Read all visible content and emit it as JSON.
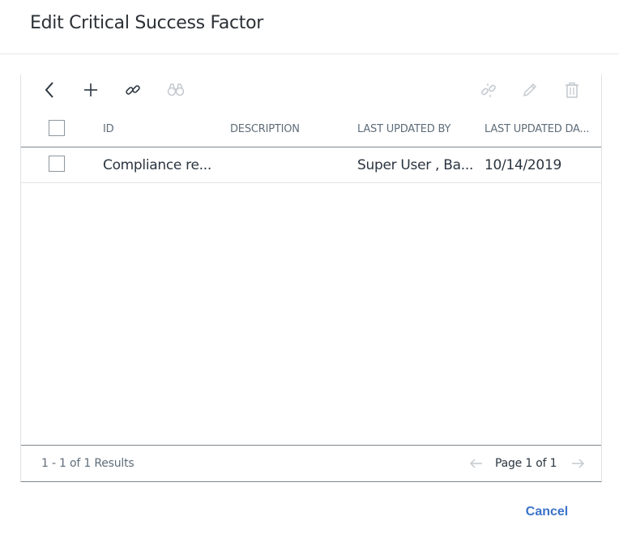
{
  "dialog": {
    "title": "Edit Critical Success Factor"
  },
  "toolbar": {
    "left_icons": [
      "back-icon",
      "add-icon",
      "link-icon",
      "search-binoculars-icon"
    ],
    "right_icons": [
      "unlink-icon",
      "edit-pencil-icon",
      "delete-trash-icon"
    ],
    "enabled_color": "#2b3540",
    "disabled_color": "#c3c9ce"
  },
  "grid": {
    "columns": [
      "ID",
      "DESCRIPTION",
      "LAST UPDATED BY",
      "LAST UPDATED DA..."
    ],
    "rows": [
      {
        "id": "Compliance re...",
        "description": "",
        "last_updated_by": "Super User , Ba...",
        "last_updated_date": "10/14/2019"
      }
    ]
  },
  "footer": {
    "results": "1 - 1 of 1 Results",
    "page_label": "Page 1 of 1"
  },
  "actions": {
    "cancel_label": "Cancel",
    "accent_color": "#3b73c9"
  }
}
